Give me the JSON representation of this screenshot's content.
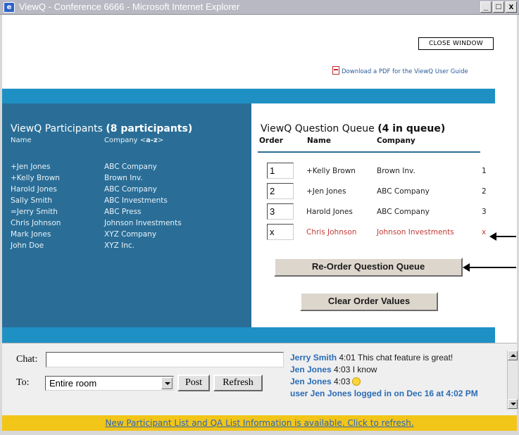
{
  "window": {
    "title": "ViewQ - Conference 6666 - Microsoft Internet Explorer",
    "minimize": "_",
    "maximize": "□",
    "close": "x"
  },
  "header": {
    "close_window": "CLOSE WINDOW",
    "pdf_link": "Download a PDF for the ViewQ User Guide"
  },
  "participants": {
    "title": "ViewQ Participants",
    "count": "(8 participants)",
    "col_name": "Name",
    "col_company_prefix": "Company <",
    "col_company_sort": "a-z",
    "col_company_suffix": ">",
    "rows": [
      {
        "name": "+Jen Jones",
        "company": "ABC Company"
      },
      {
        "name": "+Kelly Brown",
        "company": "Brown Inv."
      },
      {
        "name": "Harold Jones",
        "company": "ABC Company"
      },
      {
        "name": "Sally Smith",
        "company": "ABC Investments"
      },
      {
        "name": "=Jerry Smith",
        "company": "ABC Press"
      },
      {
        "name": "Chris Johnson",
        "company": "Johnson Investments"
      },
      {
        "name": "Mark Jones",
        "company": "XYZ Company"
      },
      {
        "name": "John Doe",
        "company": "XYZ Inc."
      }
    ]
  },
  "queue": {
    "title": "ViewQ Question Queue",
    "count": "(4 in queue)",
    "col_order": "Order",
    "col_name": "Name",
    "col_company": "Company",
    "rows": [
      {
        "order": "1",
        "name": "+Kelly Brown",
        "company": "Brown Inv.",
        "position": "1"
      },
      {
        "order": "2",
        "name": "+Jen Jones",
        "company": "ABC Company",
        "position": "2"
      },
      {
        "order": "3",
        "name": "Harold Jones",
        "company": "ABC Company",
        "position": "3"
      },
      {
        "order": "x",
        "name": "Chris Johnson",
        "company": "Johnson Investments",
        "position": "x"
      }
    ],
    "reorder_button": "Re-Order Question Queue",
    "clear_button": "Clear Order Values"
  },
  "chat": {
    "chat_label": "Chat:",
    "to_label": "To:",
    "input_value": "",
    "recipient": "Entire room",
    "post_button": "Post",
    "refresh_button": "Refresh",
    "messages": [
      {
        "who": "Jerry Smith",
        "time": "4:01",
        "text": "This chat feature is great!"
      },
      {
        "who": "Jen Jones",
        "time": "4:03",
        "text": "I know"
      },
      {
        "who": "Jen Jones",
        "time": "4:03",
        "text": ""
      }
    ],
    "system_message": "user Jen Jones logged in on Dec 16 at 4:02 PM"
  },
  "notice": "New Participant List and QA List Information is available. Click to refresh.",
  "colors": {
    "band": "#1f90c4",
    "panel": "#2a6e97",
    "notice_bg": "#f2c519",
    "removed_row": "#c03b34"
  }
}
